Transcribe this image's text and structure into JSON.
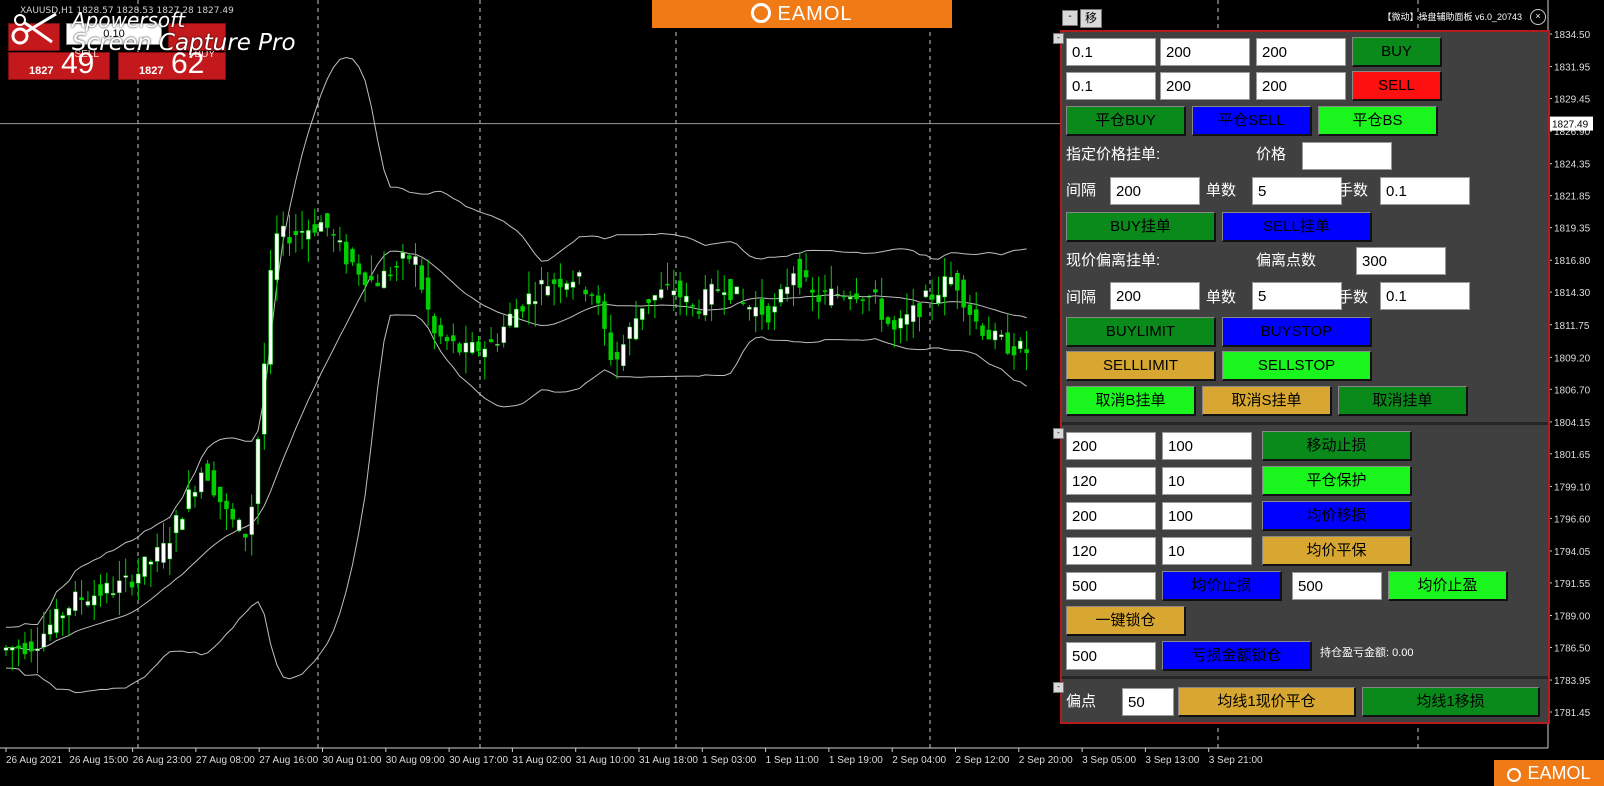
{
  "chart": {
    "symbol_header": "XAUUSD,H1 1828.57 1828.53 1827.28 1827.49",
    "current_price": "1827.49",
    "y_ticks": [
      "1834.50",
      "1831.95",
      "1829.45",
      "1826.90",
      "1824.35",
      "1821.85",
      "1819.35",
      "1816.80",
      "1814.30",
      "1811.75",
      "1809.20",
      "1806.70",
      "1804.15",
      "1801.65",
      "1799.10",
      "1796.60",
      "1794.05",
      "1791.55",
      "1789.00",
      "1786.50",
      "1783.95",
      "1781.45"
    ],
    "x_ticks": [
      "26 Aug 2021",
      "26 Aug 15:00",
      "26 Aug 23:00",
      "27 Aug 08:00",
      "27 Aug 16:00",
      "30 Aug 01:00",
      "30 Aug 09:00",
      "30 Aug 17:00",
      "31 Aug 02:00",
      "31 Aug 10:00",
      "31 Aug 18:00",
      "1 Sep 03:00",
      "1 Sep 11:00",
      "1 Sep 19:00",
      "2 Sep 04:00",
      "2 Sep 12:00",
      "2 Sep 20:00",
      "3 Sep 05:00",
      "3 Sep 13:00",
      "3 Sep 21:00"
    ],
    "colors": {
      "bull": "#ffffff",
      "bear": "#00d000",
      "band": "#bfbfbf",
      "grid": "#c8c8c8"
    }
  },
  "one_click": {
    "sell_label": "SELL",
    "buy_label": "BUY",
    "lot": "0.10",
    "sell_prefix": "1827",
    "sell_big": "49",
    "buy_prefix": "1827",
    "buy_big": "62"
  },
  "watermark": {
    "line1": "Apowersoft",
    "line2": "Screen Capture Pro"
  },
  "banner": {
    "text": "EAMOL",
    "text2": "EAMOL"
  },
  "panel": {
    "move_label": "移",
    "min_label": "-",
    "title": "【微动】操盘辅助面板 v6.0_20743",
    "close_label": "×",
    "buy_row": {
      "lots": "0.1",
      "sl": "200",
      "tp": "200",
      "btn": "BUY"
    },
    "sell_row": {
      "lots": "0.1",
      "sl": "200",
      "tp": "200",
      "btn": "SELL"
    },
    "close_buy": "平仓BUY",
    "close_sell": "平仓SELL",
    "close_bs": "平仓BS",
    "pending_title": "指定价格挂单:",
    "price_label": "价格",
    "price_value": "",
    "interval_label": "间隔",
    "interval_value": "200",
    "count_label": "单数",
    "count_value": "5",
    "lots_label": "手数",
    "lots_value": "0.1",
    "buy_pending": "BUY挂单",
    "sell_pending": "SELL挂单",
    "offset_title": "现价偏离挂单:",
    "offset_label": "偏离点数",
    "offset_value": "300",
    "interval2_value": "200",
    "count2_value": "5",
    "lots2_value": "0.1",
    "buylimit": "BUYLIMIT",
    "buystop": "BUYSTOP",
    "selllimit": "SELLLIMIT",
    "sellstop": "SELLSTOP",
    "cancel_b": "取消B挂单",
    "cancel_s": "取消S挂单",
    "cancel_all": "取消挂单",
    "trail": {
      "a": "200",
      "b": "100",
      "btn": "移动止损"
    },
    "breakeven": {
      "a": "120",
      "b": "10",
      "btn": "平仓保护"
    },
    "avg_trail": {
      "a": "200",
      "b": "100",
      "btn": "均价移损"
    },
    "avg_be": {
      "a": "120",
      "b": "10",
      "btn": "均价平保"
    },
    "avg_sl_value": "500",
    "avg_sl_btn": "均价止损",
    "avg_tp_value": "500",
    "avg_tp_btn": "均价止盈",
    "lock_btn": "一键锁仓",
    "loss_lock_value": "500",
    "loss_lock_btn": "亏损金额锁仓",
    "pnl_label": "持仓盈亏金额: 0.00",
    "offset_pts_label": "偏点",
    "offset_pts_value": "50",
    "ma_close_btn": "均线1现价平仓",
    "ma_move_btn": "均线1移损"
  }
}
